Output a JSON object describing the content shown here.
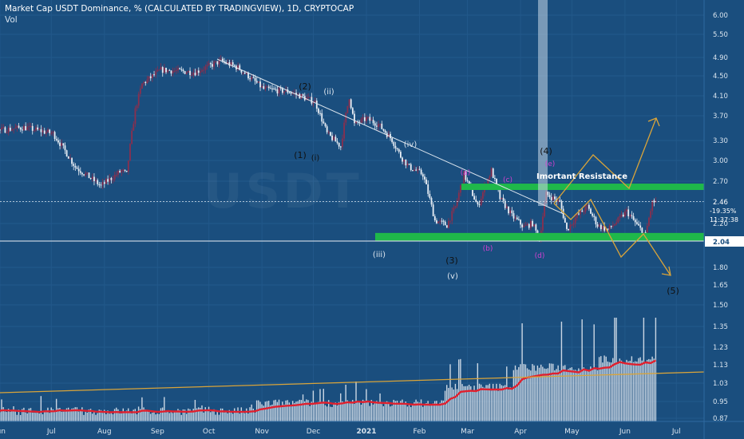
{
  "header": {
    "title": "Market Cap USDT Dominance, % (CALCULATED BY TRADINGVIEW), 1D, CRYPTOCAP",
    "indicator": "Vol"
  },
  "watermark": "USDT",
  "colors": {
    "background": "#1a4e7e",
    "candle_up": "#e8eef5",
    "candle_down": "#8a2f4e",
    "trendline": "#dde6ef",
    "zone": "#1fb84a",
    "projection": "#d9a43a",
    "volume_ma": "#e0202e",
    "wave_labels_primary": "#111111",
    "wave_labels_secondary": "#d040d0"
  },
  "chart_data": {
    "type": "candlestick",
    "title": "Market Cap USDT Dominance, % (CALCULATED BY TRADINGVIEW), 1D, CRYPTOCAP",
    "y_scale": "log",
    "y_axis_ticks": [
      "6.00",
      "5.50",
      "4.90",
      "4.50",
      "4.10",
      "3.70",
      "3.30",
      "3.00",
      "2.70",
      "2.46",
      "2.20",
      "2.04",
      "1.80",
      "1.65",
      "1.50",
      "1.35",
      "1.23",
      "1.13",
      "1.03",
      "0.95",
      "0.87"
    ],
    "x_axis_ticks": [
      "Jun",
      "Jul",
      "Aug",
      "Sep",
      "Oct",
      "Nov",
      "Dec",
      "2021",
      "Feb",
      "Mar",
      "Apr",
      "May",
      "Jun",
      "Jul"
    ],
    "price_path": [
      [
        "Jun",
        3.3
      ],
      [
        "Jul",
        3.5
      ],
      [
        "Aug",
        2.7
      ],
      [
        "Sep",
        4.6
      ],
      [
        "Oct",
        4.7
      ],
      [
        "Nov",
        4.0
      ],
      [
        "Dec",
        3.6
      ],
      [
        "2021",
        2.2
      ],
      [
        "Feb",
        2.6
      ],
      [
        "Mar",
        2.3
      ],
      [
        "Apr",
        2.2
      ],
      [
        "Apr",
        2.5
      ]
    ],
    "current_price": {
      "value": "2.46",
      "change": "-19.35%",
      "countdown": "11:37:38"
    },
    "support_line": "2.04",
    "resistance_zone": [
      2.62,
      2.68
    ],
    "support_zone": [
      2.06,
      2.12
    ],
    "annotations": {
      "resistance_label": "Imortant Resistance",
      "waves_main": [
        "(1)",
        "(2)",
        "(3)",
        "(4)",
        "(5)"
      ],
      "waves_minor": [
        "(i)",
        "(ii)",
        "(iii)",
        "(iv)",
        "(v)"
      ],
      "waves_abc": [
        "(a)",
        "(b)",
        "(c)",
        "(d)",
        "(e)"
      ]
    },
    "volume": {
      "label": "Vol",
      "ma_series": "moving average (red)",
      "trend": "orange rising line"
    },
    "projection_paths": [
      "up to ~3.7",
      "down to ~1.7 (5)"
    ]
  }
}
